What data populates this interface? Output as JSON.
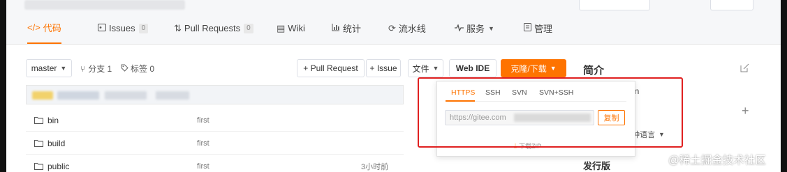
{
  "tabs": [
    {
      "label": "代码",
      "icon": "code-icon",
      "active": true
    },
    {
      "label": "Issues",
      "icon": "issue-icon",
      "count": "0"
    },
    {
      "label": "Pull Requests",
      "icon": "pull-request-icon",
      "count": "0"
    },
    {
      "label": "Wiki",
      "icon": "wiki-icon"
    },
    {
      "label": "统计",
      "icon": "chart-icon"
    },
    {
      "label": "流水线",
      "icon": "pipeline-icon"
    },
    {
      "label": "服务",
      "icon": "pulse-icon"
    },
    {
      "label": "管理",
      "icon": "manage-icon"
    }
  ],
  "toolbar": {
    "branch": "master",
    "branch_count": "分支 1",
    "tag_count": "标签 0",
    "pull_request": "+ Pull Request",
    "issue": "+ Issue",
    "file": "文件",
    "web_ide": "Web IDE",
    "clone": "克隆/下载"
  },
  "files": [
    {
      "name": "bin",
      "message": "first"
    },
    {
      "name": "build",
      "message": "first"
    },
    {
      "name": "public",
      "message": "first",
      "time": "3小时前"
    }
  ],
  "sidebar": {
    "title": "简介",
    "partial_text": "en",
    "language_fragment": "种语言",
    "releases": "发行版"
  },
  "clone_popup": {
    "tabs": [
      "HTTPS",
      "SSH",
      "SVN",
      "SVN+SSH"
    ],
    "url_placeholder": "https://gitee.com",
    "copy": "复制",
    "download_zip": "下载ZIP"
  },
  "watermark": "@稀土掘金技术社区",
  "colors": {
    "accent": "#fe7300",
    "highlight_box": "#e02020"
  }
}
